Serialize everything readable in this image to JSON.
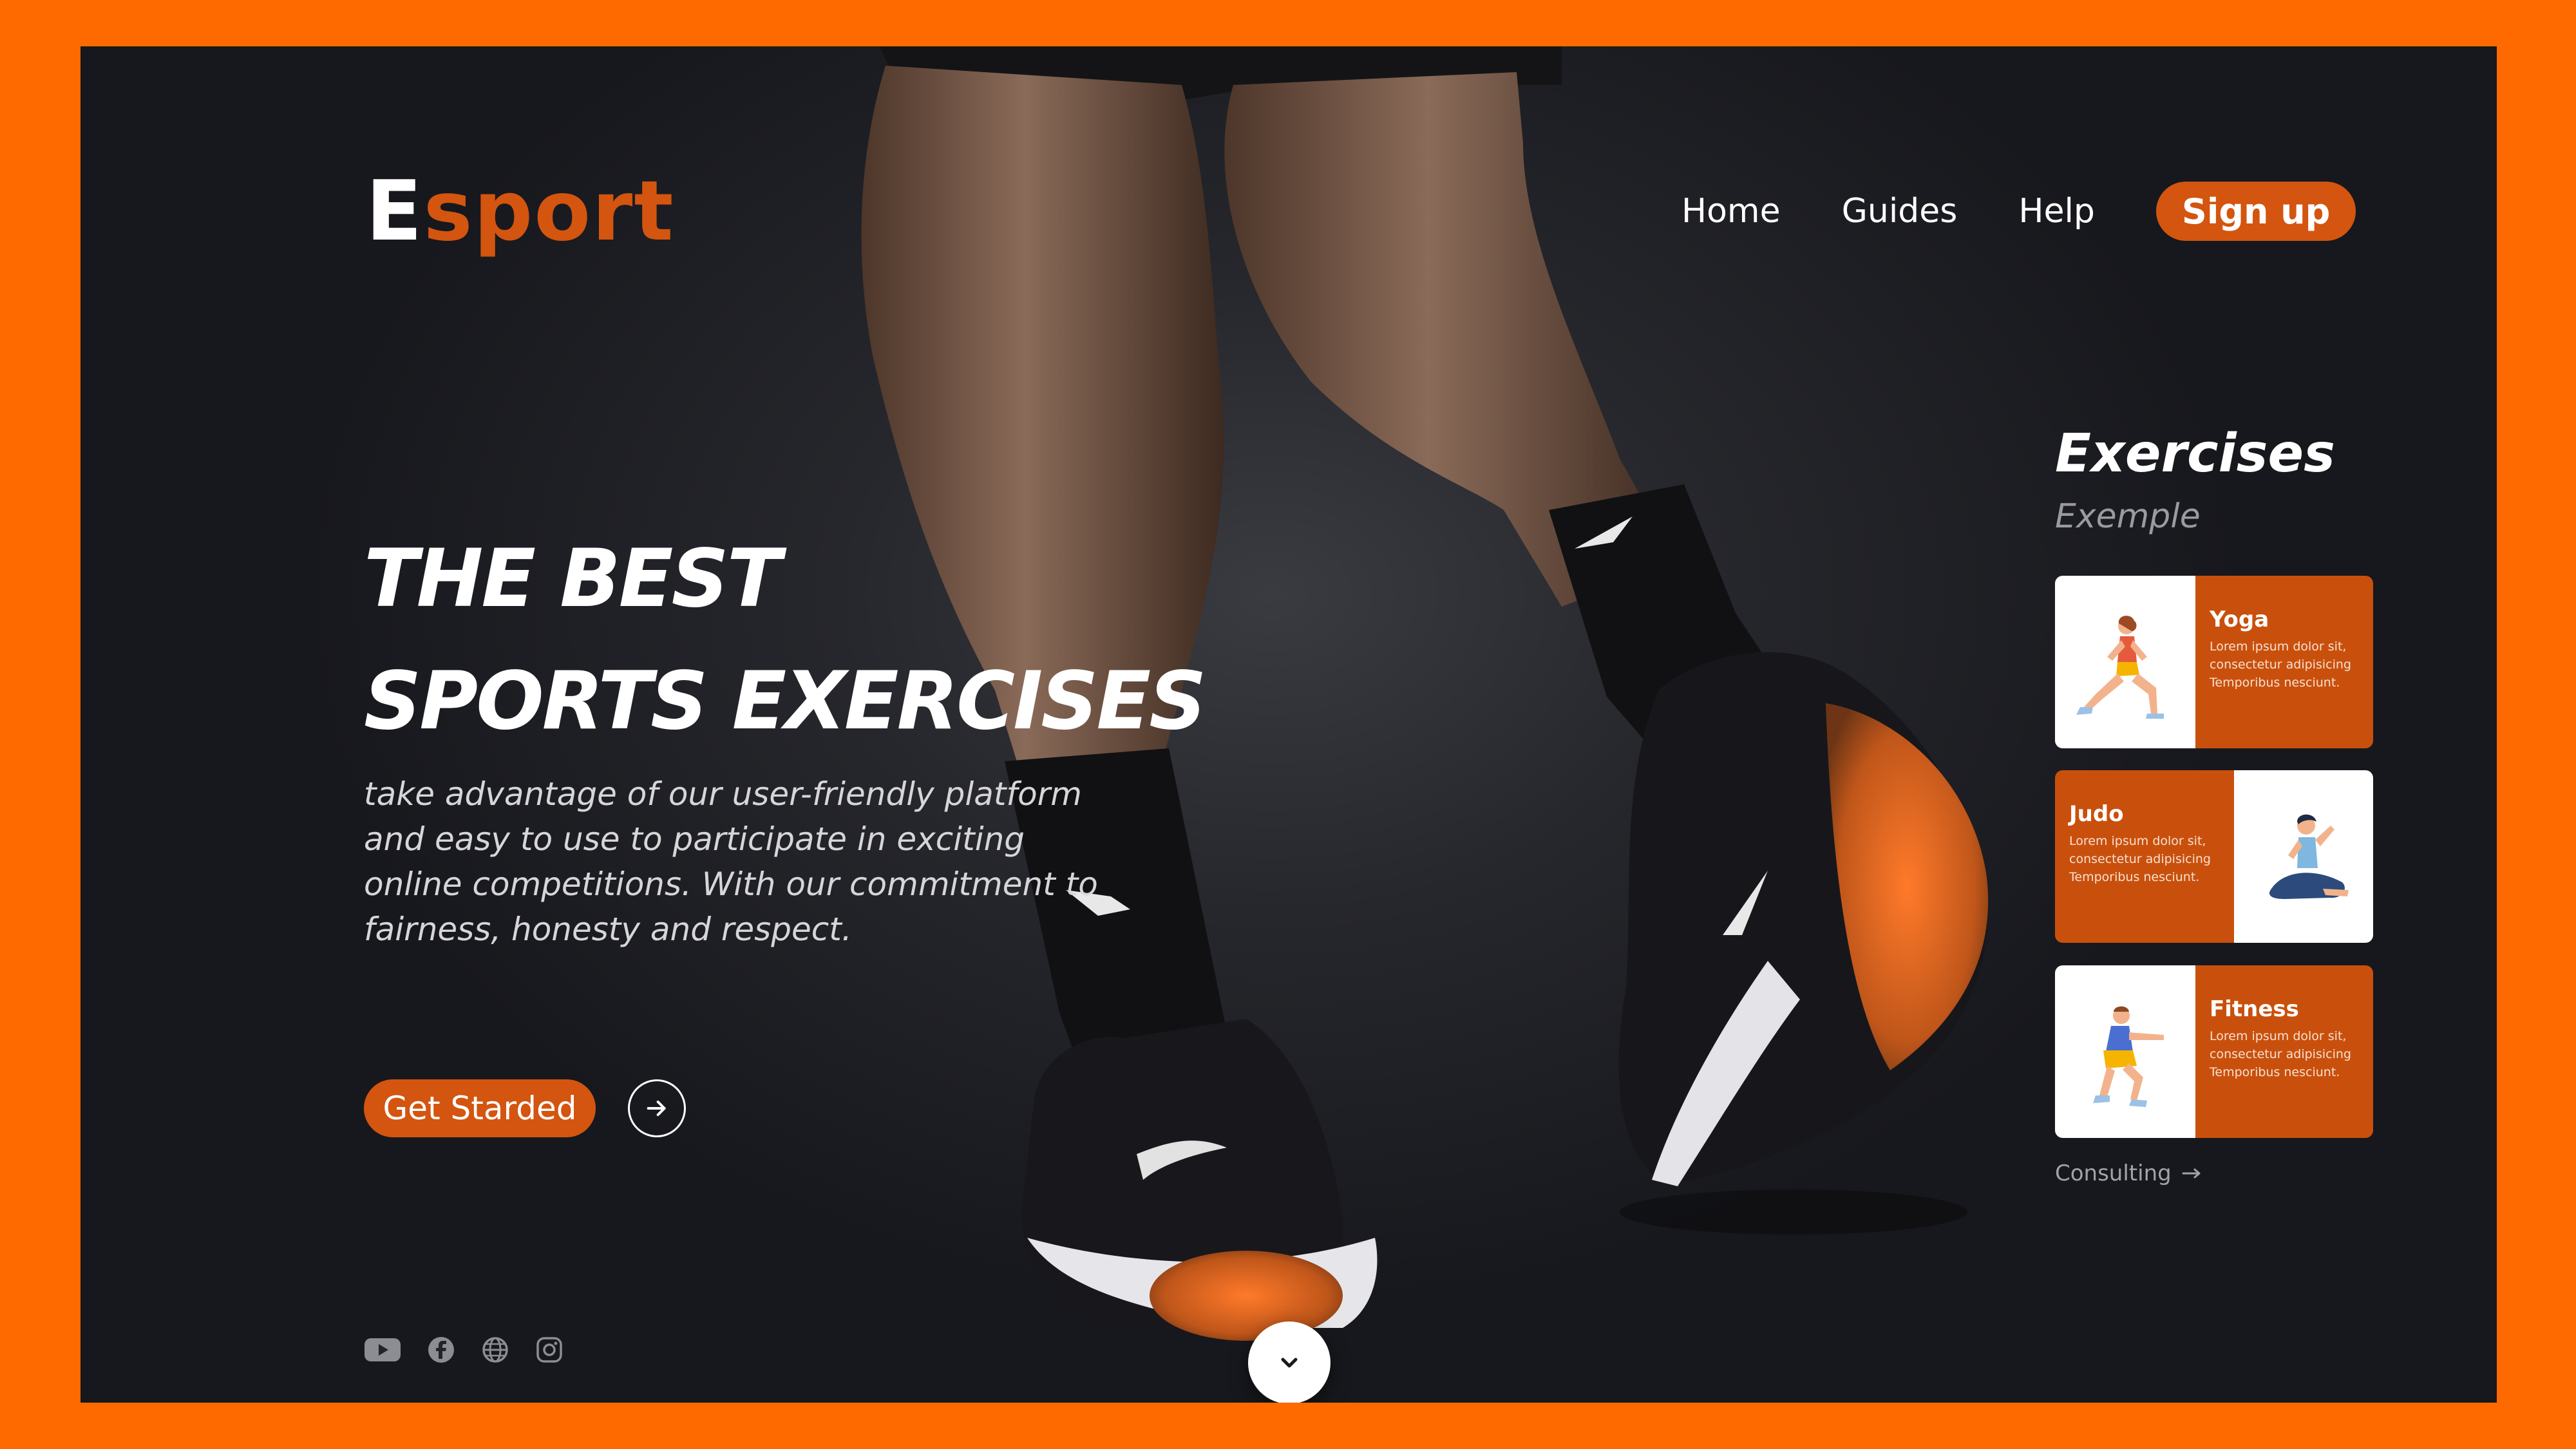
{
  "brand": {
    "logo_first": "E",
    "logo_rest": "sport"
  },
  "nav": {
    "items": [
      "Home",
      "Guides",
      "Help"
    ],
    "signup_label": "Sign up"
  },
  "hero": {
    "title_line1": "THE BEST",
    "title_line2": "SPORTS EXERCISES",
    "description": "take advantage of our user-friendly platform and easy to use to participate in exciting online competitions. With our commitment to fairness, honesty and respect.",
    "cta_label": "Get Starded"
  },
  "socials": [
    "youtube-icon",
    "facebook-icon",
    "globe-icon",
    "instagram-icon"
  ],
  "exercises": {
    "title": "Exercises",
    "subtitle": "Exemple",
    "cards": [
      {
        "title": "Yoga",
        "desc": "Lorem ipsum dolor sit, consectetur adipisicing Temporibus nesciunt."
      },
      {
        "title": "Judo",
        "desc": "Lorem ipsum dolor sit, consectetur adipisicing Temporibus nesciunt."
      },
      {
        "title": "Fitness",
        "desc": "Lorem ipsum dolor sit, consectetur adipisicing Temporibus nesciunt."
      }
    ],
    "consult_label": "Consulting"
  },
  "colors": {
    "accent": "#d3550f",
    "frame": "#fe6a00",
    "background": "#1c1d22"
  }
}
